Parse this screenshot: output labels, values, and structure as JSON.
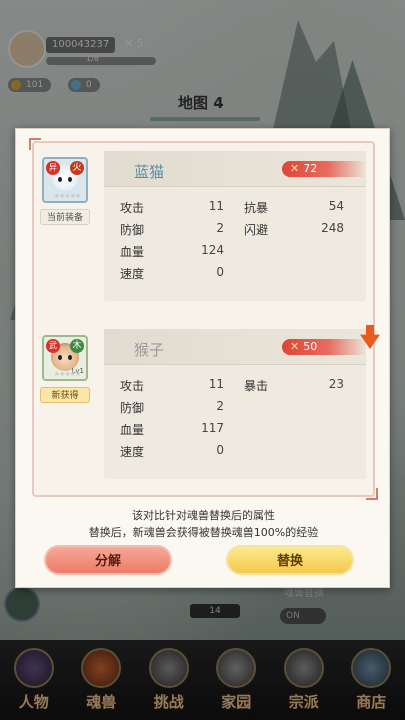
{
  "background": {
    "player_id": "100043237",
    "player_extra": "✕ 5",
    "level_text": "1/8",
    "resource_1": "101",
    "resource_2": "0",
    "map_title": "地图 4",
    "switch_label": "魂兽替换",
    "switch_state": "ON",
    "chip_value": "14"
  },
  "bottom_nav": [
    {
      "label": "人物",
      "icon": "character-icon"
    },
    {
      "label": "魂兽",
      "icon": "beast-icon"
    },
    {
      "label": "挑战",
      "icon": "swords-icon"
    },
    {
      "label": "家园",
      "icon": "home-icon"
    },
    {
      "label": "宗派",
      "icon": "sect-icon"
    },
    {
      "label": "商店",
      "icon": "shop-icon"
    }
  ],
  "current": {
    "tag": "当前装备",
    "name": "蓝猫",
    "power": "72",
    "rank_badge": "异",
    "element_badge": "火",
    "stars": "★★★★★",
    "stats_left": [
      {
        "label": "攻击",
        "value": "11"
      },
      {
        "label": "防御",
        "value": "2"
      },
      {
        "label": "血量",
        "value": "124"
      },
      {
        "label": "速度",
        "value": "0"
      }
    ],
    "stats_right": [
      {
        "label": "抗暴",
        "value": "54"
      },
      {
        "label": "闪避",
        "value": "248"
      }
    ]
  },
  "new": {
    "tag": "新获得",
    "name": "猴子",
    "power": "50",
    "rank_badge": "武",
    "element_badge": "木",
    "level": "Lv1",
    "stars": "★★★★★",
    "stats_left": [
      {
        "label": "攻击",
        "value": "11"
      },
      {
        "label": "防御",
        "value": "2"
      },
      {
        "label": "血量",
        "value": "117"
      },
      {
        "label": "速度",
        "value": "0"
      }
    ],
    "stats_right": [
      {
        "label": "暴击",
        "value": "23"
      }
    ]
  },
  "hint": {
    "line1": "该对比针对魂兽替换后的属性",
    "line2": "替换后，新魂兽会获得被替换魂兽100%的经验"
  },
  "buttons": {
    "decompose": "分解",
    "replace": "替换"
  },
  "colors": {
    "power_red": "#e0443a",
    "decompose_btn": "#ec7b68",
    "replace_btn": "#f3c94c",
    "current_name": "#5a8ea4"
  }
}
